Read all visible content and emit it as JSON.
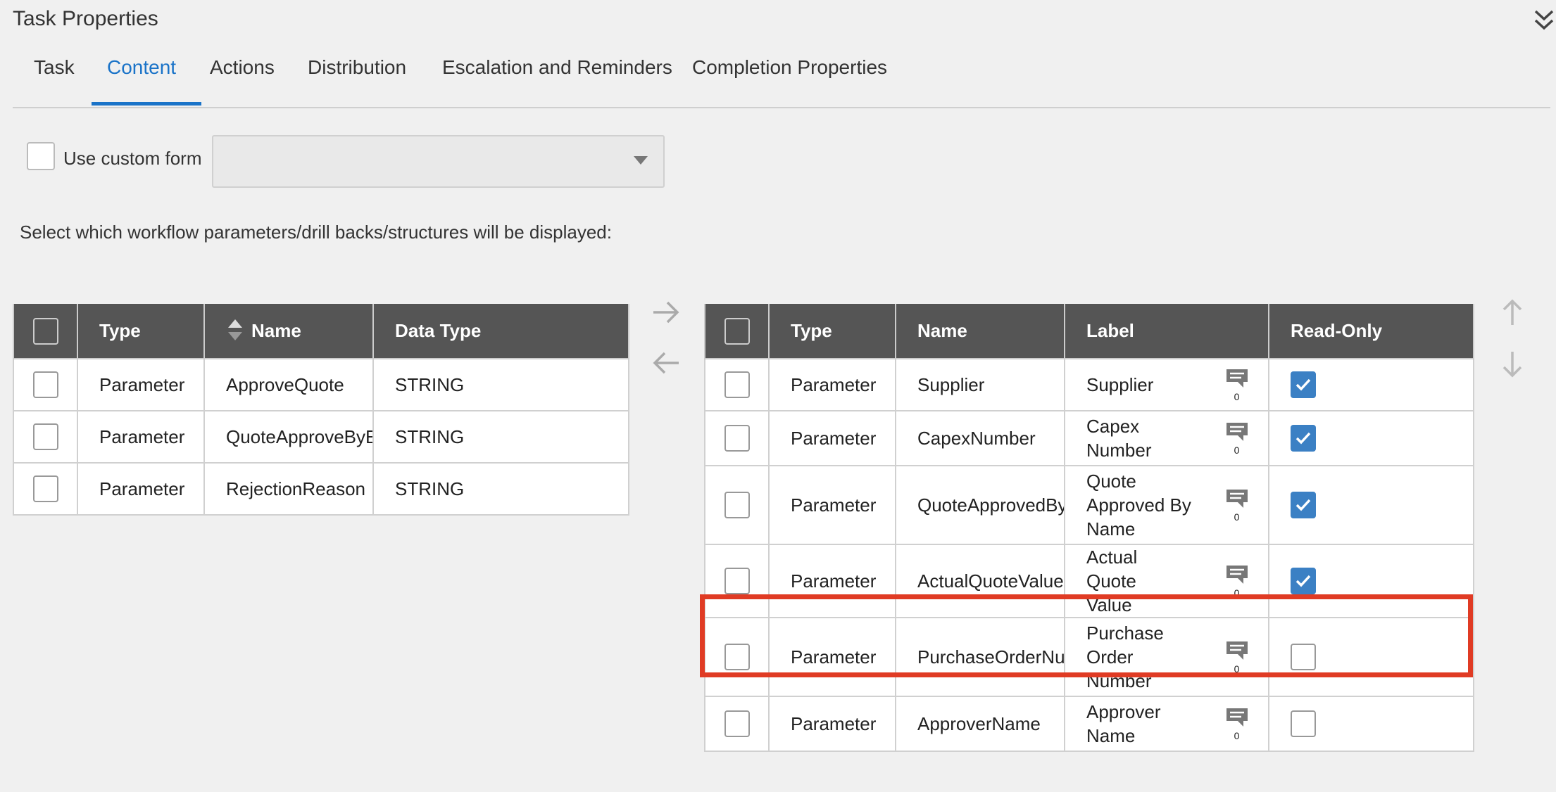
{
  "header": {
    "title": "Task Properties"
  },
  "tabs": [
    {
      "label": "Task",
      "active": false
    },
    {
      "label": "Content",
      "active": true
    },
    {
      "label": "Actions",
      "active": false
    },
    {
      "label": "Distribution",
      "active": false
    },
    {
      "label": "Escalation and Reminders",
      "active": false
    },
    {
      "label": "Completion Properties",
      "active": false
    }
  ],
  "form": {
    "custom_form_label": "Use custom form",
    "custom_form_checked": false,
    "custom_form_value": "",
    "instruction": "Select which workflow parameters/drill backs/structures will be displayed:"
  },
  "available_table": {
    "headers": {
      "type": "Type",
      "name": "Name",
      "data_type": "Data Type"
    },
    "rows": [
      {
        "type": "Parameter",
        "name": "ApproveQuote",
        "data_type": "STRING"
      },
      {
        "type": "Parameter",
        "name": "QuoteApproveByEU",
        "data_type": "STRING"
      },
      {
        "type": "Parameter",
        "name": "RejectionReason",
        "data_type": "STRING"
      }
    ]
  },
  "selected_table": {
    "headers": {
      "type": "Type",
      "name": "Name",
      "label": "Label",
      "read_only": "Read-Only"
    },
    "rows": [
      {
        "type": "Parameter",
        "name": "Supplier",
        "label": "Supplier",
        "comments": "0",
        "read_only": true
      },
      {
        "type": "Parameter",
        "name": "CapexNumber",
        "label": "Capex Number",
        "comments": "0",
        "read_only": true
      },
      {
        "type": "Parameter",
        "name": "QuoteApprovedBy",
        "label": "Quote Approved By Name",
        "comments": "0",
        "read_only": true
      },
      {
        "type": "Parameter",
        "name": "ActualQuoteValue",
        "label": "Actual Quote Value",
        "comments": "0",
        "read_only": true
      },
      {
        "type": "Parameter",
        "name": "PurchaseOrderNumber",
        "label": "Purchase Order Number",
        "comments": "0",
        "read_only": false
      },
      {
        "type": "Parameter",
        "name": "ApproverName",
        "label": "Approver Name",
        "comments": "0",
        "read_only": false
      }
    ]
  },
  "icons": {
    "collapse": "double-chevron-down-icon",
    "move_right": "arrow-right-icon",
    "move_left": "arrow-left-icon",
    "move_up": "arrow-up-icon",
    "move_down": "arrow-down-icon",
    "comment": "comment-icon",
    "sort": "sort-icon"
  },
  "colors": {
    "accent": "#1a73c8",
    "header_bg": "#555555",
    "checkbox_checked": "#3b80c4",
    "highlight": "#e03b24"
  }
}
